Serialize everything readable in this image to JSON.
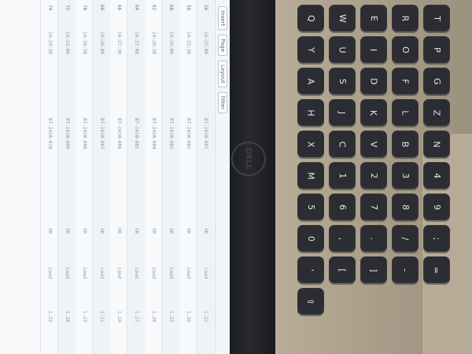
{
  "screen": {
    "toolbar": [
      "Insert",
      "Page",
      "Layout",
      "Filter"
    ],
    "rows": [
      {
        "c0": "56",
        "c1": "14:25:00",
        "c2": "BT-2410-001",
        "c3": "OK",
        "c4": "Load",
        "c5": "1.22"
      },
      {
        "c0": "58",
        "c1": "14:25:30",
        "c2": "BT-2410-002",
        "c3": "OK",
        "c4": "Load",
        "c5": "1.26"
      },
      {
        "c0": "60",
        "c1": "14:26:00",
        "c2": "BT-2410-003",
        "c3": "OK",
        "c4": "Load",
        "c5": "1.25"
      },
      {
        "c0": "62",
        "c1": "14:26:30",
        "c2": "BT-2410-004",
        "c3": "OK",
        "c4": "Load",
        "c5": "1.20"
      },
      {
        "c0": "64",
        "c1": "14:27:00",
        "c2": "BT-2410-005",
        "c3": "OK",
        "c4": "Load",
        "c5": "1.27"
      },
      {
        "c0": "66",
        "c1": "14:27:30",
        "c2": "BT-2410-006",
        "c3": "OK",
        "c4": "Load",
        "c5": "1.24"
      },
      {
        "c0": "68",
        "c1": "14:28:00",
        "c2": "BT-2410-007",
        "c3": "OK",
        "c4": "Load",
        "c5": "1.21"
      },
      {
        "c0": "70",
        "c1": "14:28:30",
        "c2": "BT-2410-008",
        "c3": "OK",
        "c4": "Load",
        "c5": "1.23"
      },
      {
        "c0": "72",
        "c1": "14:29:00",
        "c2": "BT-2410-009",
        "c3": "OK",
        "c4": "Load",
        "c5": "1.28"
      },
      {
        "c0": "74",
        "c1": "14:29:30",
        "c2": "BT-2410-010",
        "c3": "OK",
        "c4": "Load",
        "c5": "1.22"
      }
    ]
  },
  "bezel": {
    "logo": "DELL"
  },
  "keyboard": {
    "keys": [
      "Q",
      "W",
      "E",
      "R",
      "T",
      "Y",
      "U",
      "I",
      "O",
      "P",
      "A",
      "S",
      "D",
      "F",
      "G",
      "H",
      "J",
      "K",
      "L",
      "Z",
      "X",
      "C",
      "V",
      "B",
      "N",
      "M",
      "1",
      "2",
      "3",
      "4",
      "5",
      "6",
      "7",
      "8",
      "9",
      "0",
      ",",
      ".",
      "/",
      ";",
      "'",
      "[",
      "]",
      "-",
      "=",
      "⇧"
    ]
  }
}
